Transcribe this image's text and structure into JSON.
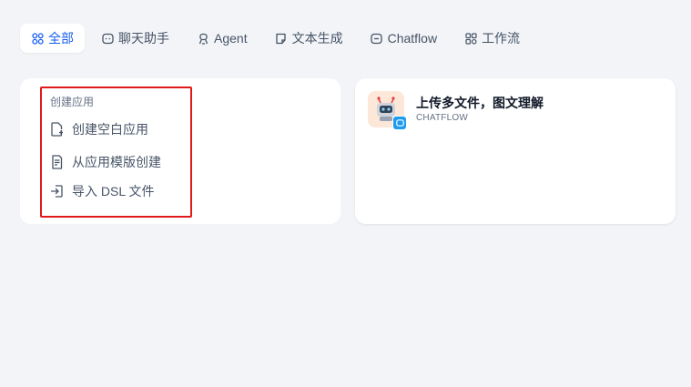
{
  "tabs": [
    {
      "label": "全部",
      "icon": "grid-icon",
      "active": true
    },
    {
      "label": "聊天助手",
      "icon": "chat-bubble-icon"
    },
    {
      "label": "Agent",
      "icon": "agent-icon"
    },
    {
      "label": "文本生成",
      "icon": "note-icon"
    },
    {
      "label": "Chatflow",
      "icon": "chat-flow-icon"
    },
    {
      "label": "工作流",
      "icon": "workflow-icon"
    }
  ],
  "create": {
    "title": "创建应用",
    "items": [
      {
        "label": "创建空白应用",
        "icon": "file-plus-icon"
      },
      {
        "label": "从应用模版创建",
        "icon": "template-icon"
      },
      {
        "label": "导入 DSL 文件",
        "icon": "import-icon"
      }
    ]
  },
  "app": {
    "name": "上传多文件，图文理解",
    "type": "CHATFLOW",
    "icon": "robot-icon",
    "badge_icon": "chat-badge-icon"
  },
  "colors": {
    "accent": "#155eef",
    "highlight_border": "#e0191c",
    "background": "#f2f4f7"
  }
}
